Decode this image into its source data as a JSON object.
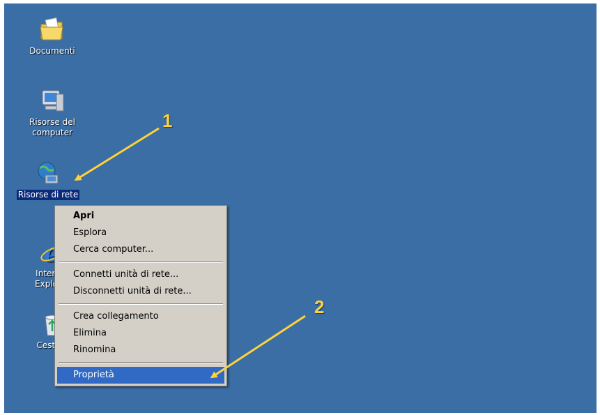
{
  "desktop": {
    "background": "#3a6ea5",
    "icons": [
      {
        "label": "Documenti",
        "icon": "my-documents-folder-icon"
      },
      {
        "label": "Risorse del computer",
        "icon": "my-computer-icon"
      },
      {
        "label": "Risorse di rete",
        "icon": "network-places-icon",
        "selected": true
      },
      {
        "label": "Internet Explorer",
        "icon": "internet-explorer-icon"
      },
      {
        "label": "Cestino",
        "icon": "recycle-bin-icon"
      }
    ]
  },
  "context_menu": {
    "groups": [
      [
        "Apri",
        "Esplora",
        "Cerca computer..."
      ],
      [
        "Connetti unità di rete...",
        "Disconnetti unità di rete..."
      ],
      [
        "Crea collegamento",
        "Elimina",
        "Rinomina"
      ],
      [
        "Proprietà"
      ]
    ],
    "default_item": "Apri",
    "highlighted_item": "Proprietà",
    "highlight_color": "#316ac5"
  },
  "annotations": {
    "step1_number": "1",
    "step2_number": "2",
    "arrow_color": "#ffd23a"
  }
}
